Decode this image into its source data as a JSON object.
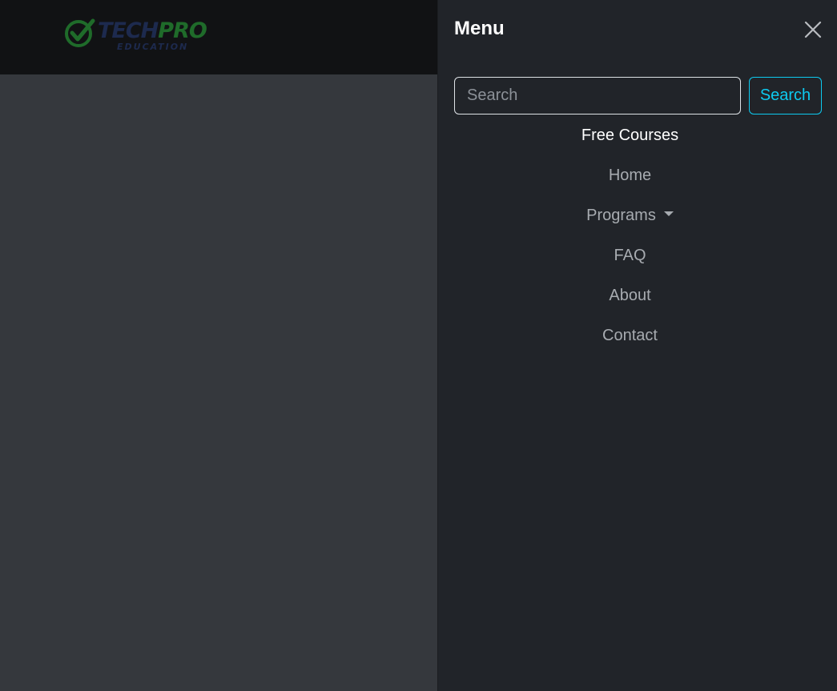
{
  "brand": {
    "word_part1": "TECH",
    "word_part2": "PRO",
    "subtitle": "EDUCATION",
    "colors": {
      "green": "#1f6b2a",
      "navy": "#1d2a4e"
    }
  },
  "menu": {
    "title": "Menu",
    "close_icon": "close-icon",
    "search": {
      "placeholder": "Search",
      "value": "",
      "button_label": "Search"
    },
    "items": [
      {
        "label": "Free Courses",
        "active": true
      },
      {
        "label": "Home"
      },
      {
        "label": "Programs",
        "dropdown": true
      },
      {
        "label": "FAQ"
      },
      {
        "label": "About"
      },
      {
        "label": "Contact"
      }
    ]
  },
  "colors": {
    "backdrop": "#35383d",
    "navbar": "#111214",
    "panel": "#212429",
    "accent": "#0dcaf0"
  }
}
